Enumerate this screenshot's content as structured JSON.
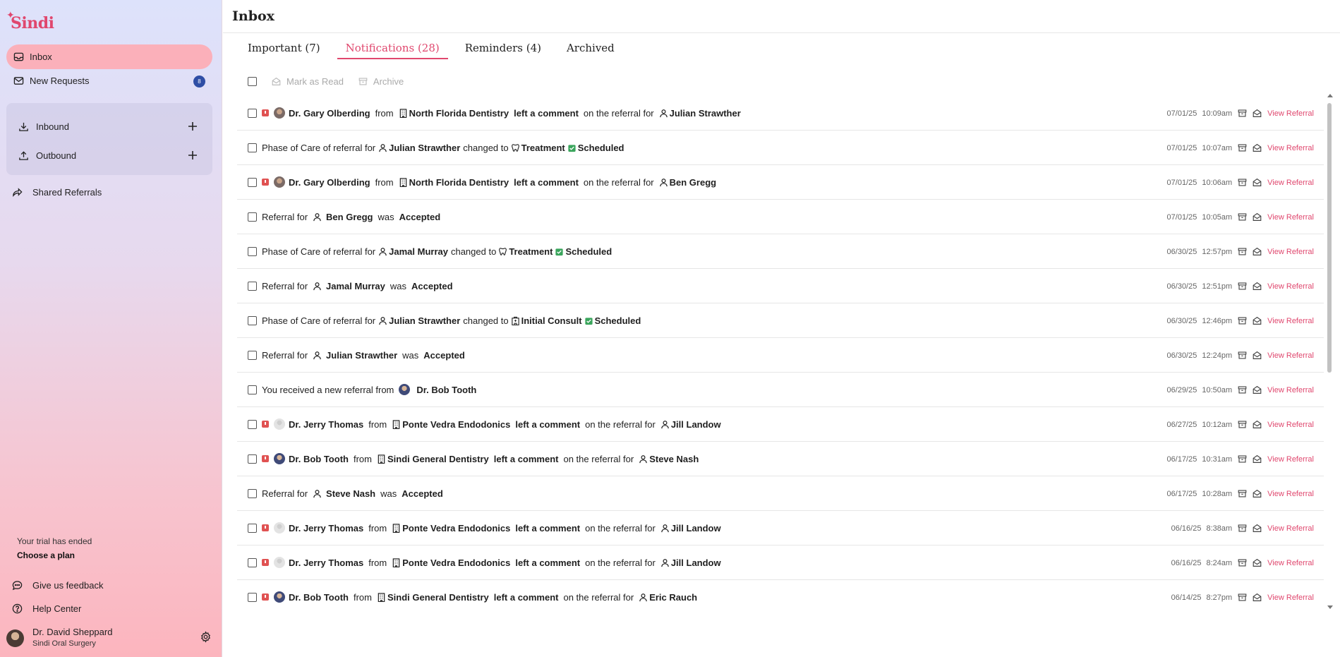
{
  "app": {
    "name": "Sindi"
  },
  "sidebar": {
    "inbox": "Inbox",
    "new_requests": "New Requests",
    "new_requests_count": "8",
    "inbound": "Inbound",
    "outbound": "Outbound",
    "shared": "Shared Referrals",
    "trial": "Your trial has ended",
    "plan": "Choose a plan",
    "feedback": "Give us feedback",
    "help": "Help Center",
    "user_name": "Dr. David Sheppard",
    "user_org": "Sindi Oral Surgery"
  },
  "header": {
    "title": "Inbox"
  },
  "tabs": [
    {
      "label": "Important (7)"
    },
    {
      "label": "Notifications (28)"
    },
    {
      "label": "Reminders (4)"
    },
    {
      "label": "Archived"
    }
  ],
  "toolbar": {
    "mark_read": "Mark as Read",
    "archive": "Archive"
  },
  "strings": {
    "from": "from",
    "left_comment": "left a comment",
    "on_referral": "on the referral for",
    "phase": "Phase of Care of referral for",
    "changed_to": "changed to",
    "referral_for": "Referral for",
    "was": "was",
    "received": "You received a new referral from",
    "view": "View Referral"
  },
  "rows": [
    {
      "type": "comment",
      "flag": true,
      "avatar": "gary",
      "doctor": "Dr. Gary Olberding",
      "practice": "North Florida Dentistry",
      "patient": "Julian Strawther",
      "date": "07/01/25",
      "time": "10:09am"
    },
    {
      "type": "phase",
      "patient": "Julian Strawther",
      "phase": "Treatment",
      "phase_icon": "tooth",
      "status": "Scheduled",
      "date": "07/01/25",
      "time": "10:07am"
    },
    {
      "type": "comment",
      "flag": true,
      "avatar": "gary",
      "doctor": "Dr. Gary Olberding",
      "practice": "North Florida Dentistry",
      "patient": "Ben Gregg",
      "date": "07/01/25",
      "time": "10:06am"
    },
    {
      "type": "status",
      "patient": "Ben Gregg",
      "status": "Accepted",
      "date": "07/01/25",
      "time": "10:05am"
    },
    {
      "type": "phase",
      "patient": "Jamal Murray",
      "phase": "Treatment",
      "phase_icon": "tooth",
      "status": "Scheduled",
      "date": "06/30/25",
      "time": "12:57pm"
    },
    {
      "type": "status",
      "patient": "Jamal Murray",
      "status": "Accepted",
      "date": "06/30/25",
      "time": "12:51pm"
    },
    {
      "type": "phase",
      "patient": "Julian Strawther",
      "phase": "Initial Consult",
      "phase_icon": "clinic",
      "status": "Scheduled",
      "date": "06/30/25",
      "time": "12:46pm"
    },
    {
      "type": "status",
      "patient": "Julian Strawther",
      "status": "Accepted",
      "date": "06/30/25",
      "time": "12:24pm"
    },
    {
      "type": "received",
      "avatar": "bob",
      "doctor": "Dr. Bob Tooth",
      "date": "06/29/25",
      "time": "10:50am"
    },
    {
      "type": "comment",
      "flag": true,
      "avatar": "jerry",
      "doctor": "Dr. Jerry Thomas",
      "practice": "Ponte Vedra Endodonics",
      "patient": "Jill Landow",
      "date": "06/27/25",
      "time": "10:12am"
    },
    {
      "type": "comment",
      "flag": true,
      "avatar": "bob",
      "doctor": "Dr. Bob Tooth",
      "practice": "Sindi General Dentistry",
      "patient": "Steve Nash",
      "date": "06/17/25",
      "time": "10:31am"
    },
    {
      "type": "status",
      "patient": "Steve Nash",
      "status": "Accepted",
      "date": "06/17/25",
      "time": "10:28am"
    },
    {
      "type": "comment",
      "flag": true,
      "avatar": "jerry",
      "doctor": "Dr. Jerry Thomas",
      "practice": "Ponte Vedra Endodonics",
      "patient": "Jill Landow",
      "date": "06/16/25",
      "time": "8:38am"
    },
    {
      "type": "comment",
      "flag": true,
      "avatar": "jerry",
      "doctor": "Dr. Jerry Thomas",
      "practice": "Ponte Vedra Endodonics",
      "patient": "Jill Landow",
      "date": "06/16/25",
      "time": "8:24am"
    },
    {
      "type": "comment",
      "flag": true,
      "avatar": "bob",
      "doctor": "Dr. Bob Tooth",
      "practice": "Sindi General Dentistry",
      "patient": "Eric Rauch",
      "date": "06/14/25",
      "time": "8:27pm"
    }
  ],
  "colors": {
    "accent": "#e0476e",
    "badge": "#2f4ea5",
    "flag": "#e05252",
    "scheduled": "#3aa55c"
  }
}
